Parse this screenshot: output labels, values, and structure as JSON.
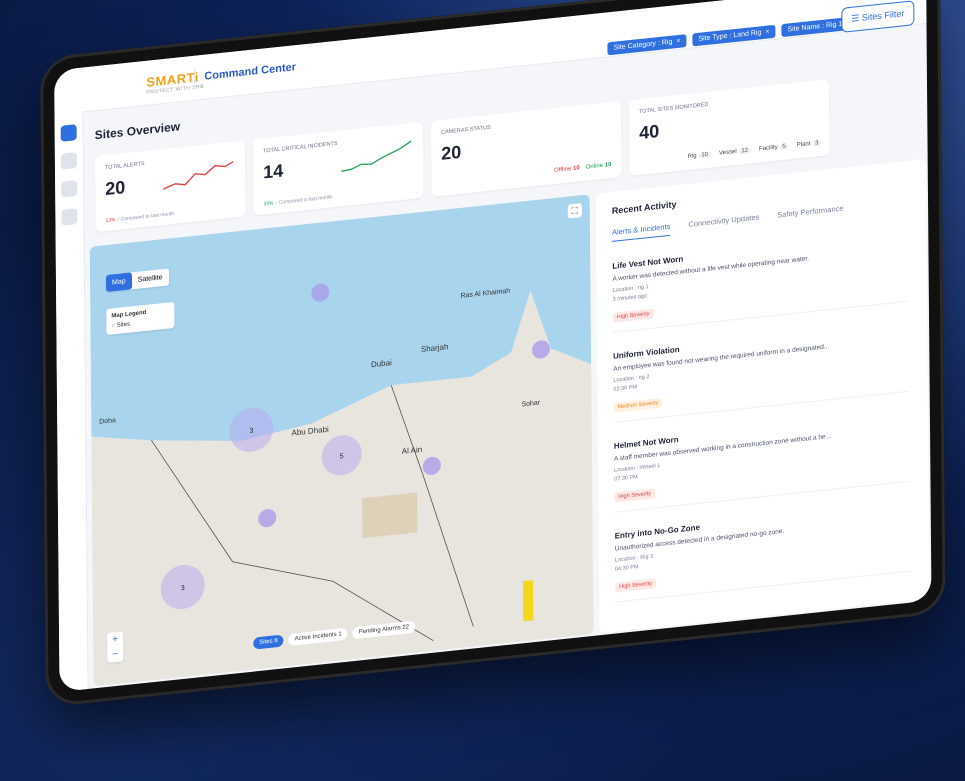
{
  "app": {
    "logo": "SMARTi",
    "logo_sub": "PROTECT WITH SRB",
    "section": "Command Center"
  },
  "filters": {
    "chips": [
      "Site Category : Rig",
      "Site Type : Land Rig",
      "Site Name : Rig 1"
    ],
    "button": "Sites Filter"
  },
  "page": {
    "title": "Sites Overview"
  },
  "cards": {
    "alerts": {
      "label": "TOTAL ALERTS",
      "value": "20",
      "change": "13%",
      "compare": "Compared to last month"
    },
    "critical": {
      "label": "TOTAL CRITICAL INCIDENTS",
      "value": "14",
      "change": "33%",
      "compare": "Compared to last month"
    },
    "cameras": {
      "label": "CAMERAS STATUS",
      "value": "20",
      "offline_label": "Offline",
      "offline": "10",
      "online_label": "Online",
      "online": "10"
    },
    "sites": {
      "label": "TOTAL SITES MONITORED",
      "value": "40",
      "types": [
        {
          "name": "Rig",
          "count": "10"
        },
        {
          "name": "Vessel",
          "count": "12"
        },
        {
          "name": "Facility",
          "count": "5"
        },
        {
          "name": "Plant",
          "count": "3"
        }
      ]
    }
  },
  "map": {
    "toggle": [
      "Map",
      "Satellite"
    ],
    "legend_title": "Map Legend",
    "legend_item": "Sites",
    "zoom_in": "+",
    "zoom_out": "−",
    "bottom_tabs": [
      {
        "label": "Sites",
        "count": "8"
      },
      {
        "label": "Active Incidents",
        "count": "1"
      },
      {
        "label": "Pending Alarms",
        "count": "22"
      }
    ],
    "places": [
      "Doha",
      "Dubai",
      "Sharjah",
      "Abu Dhabi",
      "Al Ain",
      "Ras Al Khaimah",
      "Sohar"
    ]
  },
  "activity": {
    "title": "Recent Activity",
    "tabs": [
      "Alerts & Incidents",
      "Connectivity Updates",
      "Safety Performance"
    ],
    "items": [
      {
        "title": "Life Vest Not Worn",
        "desc": "A worker was detected without a life vest while operating near water.",
        "location": "Location : rig 1",
        "time": "3 minutes ago",
        "severity": "High Severity"
      },
      {
        "title": "Uniform Violation",
        "desc": "An employee was found not wearing the required uniform in a designated...",
        "location": "Location : rig 2",
        "time": "02:30 PM",
        "severity": "Medium Severity"
      },
      {
        "title": "Helmet Not Worn",
        "desc": "A staff member was observed working in a construction zone without a he...",
        "location": "Location : Vessel 1",
        "time": "07:30 PM",
        "severity": "High Severity"
      },
      {
        "title": "Entry into No-Go Zone",
        "desc": "Unauthorized access detected in a designated no-go zone.",
        "location": "Location : Rig 3",
        "time": "04:30 PM",
        "severity": "High Severity"
      }
    ]
  }
}
